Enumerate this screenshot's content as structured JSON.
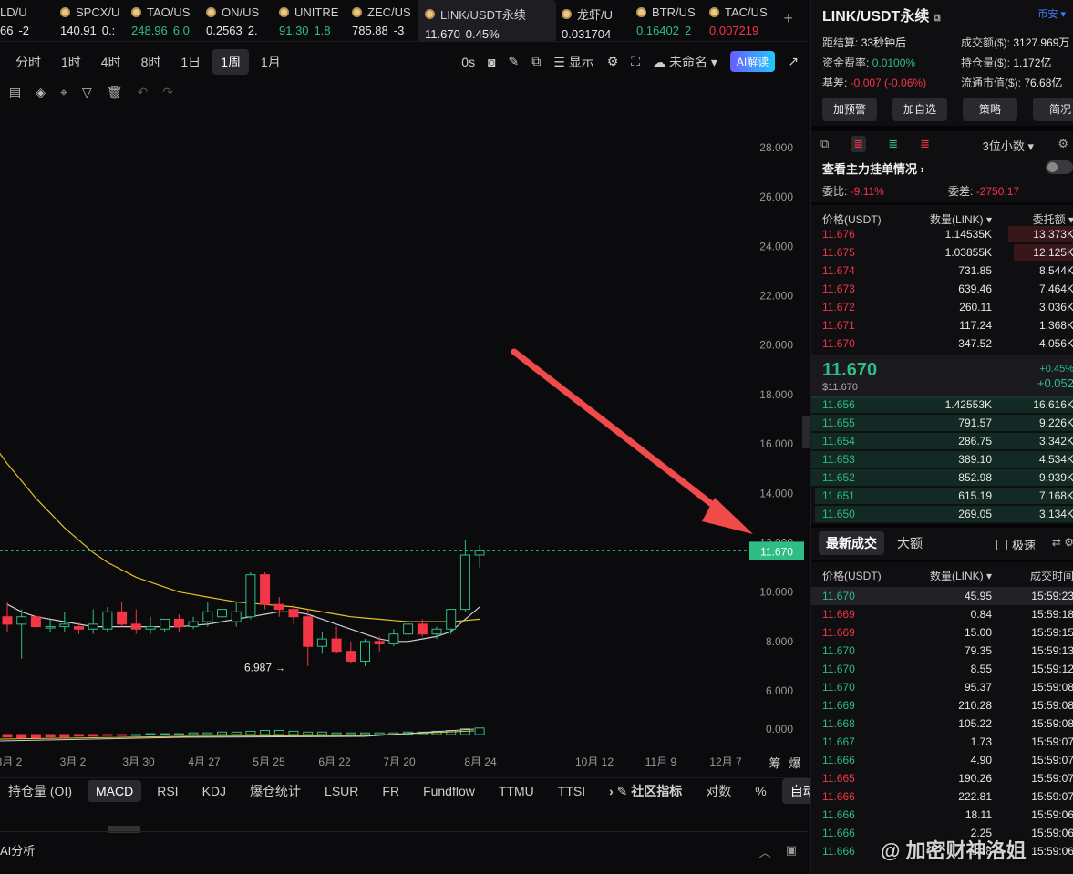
{
  "ticker": [
    {
      "name": "LD/U",
      "price": "66",
      "change": "-2",
      "pc": "wh",
      "cc": "wh",
      "dot": false,
      "w": 60
    },
    {
      "name": "SPCX/U",
      "price": "140.91",
      "change": "0.:",
      "pc": "wh",
      "cc": "wh",
      "dot": true,
      "w": 78
    },
    {
      "name": "TAO/US",
      "price": "248.96",
      "change": "6.0",
      "pc": "up",
      "cc": "up",
      "dot": true,
      "w": 82
    },
    {
      "name": "ON/US",
      "price": "0.2563",
      "change": "2.",
      "pc": "wh",
      "cc": "wh",
      "dot": true,
      "w": 80
    },
    {
      "name": "UNITRE",
      "price": "91.30",
      "change": "1.8",
      "pc": "up",
      "cc": "up",
      "dot": true,
      "w": 80
    },
    {
      "name": "ZEC/US",
      "price": "785.88",
      "change": "-3",
      "pc": "wh",
      "cc": "wh",
      "dot": true,
      "w": 78
    },
    {
      "name": "LINK/USDT永续",
      "price": "11.670",
      "change": "0.45%",
      "pc": "wh",
      "cc": "wh",
      "dot": true,
      "w": 152,
      "active": true
    },
    {
      "name": "龙虾/U",
      "price": "0.031704",
      "change": "",
      "pc": "wh",
      "cc": "wh",
      "dot": true,
      "w": 82
    },
    {
      "name": "BTR/US",
      "price": "0.16402",
      "change": "2",
      "pc": "up",
      "cc": "up",
      "dot": true,
      "w": 80
    },
    {
      "name": "TAC/US",
      "price": "0.007219",
      "change": "",
      "pc": "dn",
      "cc": "dn",
      "dot": true,
      "w": 80
    }
  ],
  "timeframes": [
    "分时",
    "1时",
    "4时",
    "8时",
    "1日",
    "1周",
    "1月"
  ],
  "active_timeframe": "1周",
  "toolbar_right": {
    "countdown": "0s",
    "display": "显示",
    "layout": "未命名",
    "ai": "AI解读"
  },
  "chart_data": {
    "type": "candlestick",
    "y_ticks": [
      "28.000",
      "26.000",
      "24.000",
      "22.000",
      "20.000",
      "18.000",
      "16.000",
      "14.000",
      "12.000",
      "10.000",
      "8.000",
      "6.000",
      "0.000"
    ],
    "x_ticks": [
      "8月 2",
      "3月 2",
      "3月 30",
      "4月 27",
      "5月 25",
      "6月 22",
      "7月 20",
      "8月 24",
      "10月 12",
      "11月 9",
      "12月 7"
    ],
    "last_price": "11.670",
    "low_marker": "6.987",
    "right_labels": [
      "筹",
      "爆"
    ],
    "candles": [
      {
        "o": 9.0,
        "h": 9.6,
        "l": 8.4,
        "c": 8.7
      },
      {
        "o": 8.7,
        "h": 9.3,
        "l": 7.3,
        "c": 9.0
      },
      {
        "o": 9.0,
        "h": 9.4,
        "l": 8.4,
        "c": 8.6
      },
      {
        "o": 8.6,
        "h": 8.9,
        "l": 8.4,
        "c": 8.6
      },
      {
        "o": 8.6,
        "h": 9.2,
        "l": 8.4,
        "c": 8.7
      },
      {
        "o": 8.6,
        "h": 8.8,
        "l": 8.3,
        "c": 8.5
      },
      {
        "o": 8.5,
        "h": 9.3,
        "l": 8.3,
        "c": 8.7
      },
      {
        "o": 8.5,
        "h": 9.4,
        "l": 8.4,
        "c": 9.2
      },
      {
        "o": 9.2,
        "h": 9.6,
        "l": 8.6,
        "c": 8.7
      },
      {
        "o": 8.7,
        "h": 9.3,
        "l": 8.3,
        "c": 8.5
      },
      {
        "o": 8.5,
        "h": 9.0,
        "l": 8.3,
        "c": 8.6
      },
      {
        "o": 8.5,
        "h": 8.9,
        "l": 8.4,
        "c": 8.9
      },
      {
        "o": 8.9,
        "h": 9.1,
        "l": 8.4,
        "c": 8.6
      },
      {
        "o": 8.6,
        "h": 9.0,
        "l": 8.5,
        "c": 8.8
      },
      {
        "o": 8.8,
        "h": 9.6,
        "l": 8.6,
        "c": 9.2
      },
      {
        "o": 9.0,
        "h": 9.7,
        "l": 8.8,
        "c": 9.3
      },
      {
        "o": 8.8,
        "h": 9.6,
        "l": 8.6,
        "c": 9.2
      },
      {
        "o": 9.0,
        "h": 10.8,
        "l": 8.9,
        "c": 10.7
      },
      {
        "o": 10.7,
        "h": 10.8,
        "l": 9.3,
        "c": 9.5
      },
      {
        "o": 9.5,
        "h": 9.8,
        "l": 9.0,
        "c": 9.3
      },
      {
        "o": 9.3,
        "h": 9.5,
        "l": 8.7,
        "c": 9.0
      },
      {
        "o": 9.0,
        "h": 9.3,
        "l": 7.0,
        "c": 7.8
      },
      {
        "o": 7.8,
        "h": 8.4,
        "l": 7.5,
        "c": 8.1
      },
      {
        "o": 8.1,
        "h": 8.6,
        "l": 7.5,
        "c": 7.6
      },
      {
        "o": 7.6,
        "h": 8.0,
        "l": 7.1,
        "c": 7.2
      },
      {
        "o": 7.2,
        "h": 8.1,
        "l": 7.0,
        "c": 8.0
      },
      {
        "o": 8.0,
        "h": 8.2,
        "l": 7.6,
        "c": 7.9
      },
      {
        "o": 7.9,
        "h": 8.5,
        "l": 7.8,
        "c": 8.3
      },
      {
        "o": 8.3,
        "h": 8.8,
        "l": 8.0,
        "c": 8.7
      },
      {
        "o": 8.7,
        "h": 8.9,
        "l": 8.2,
        "c": 8.3
      },
      {
        "o": 8.3,
        "h": 8.6,
        "l": 8.1,
        "c": 8.5
      },
      {
        "o": 8.5,
        "h": 9.3,
        "l": 8.3,
        "c": 9.3
      },
      {
        "o": 9.3,
        "h": 12.1,
        "l": 9.2,
        "c": 11.5
      },
      {
        "o": 11.5,
        "h": 11.9,
        "l": 11.0,
        "c": 11.67
      }
    ],
    "ma_white": [
      9.5,
      9.2,
      9.0,
      8.9,
      8.8,
      8.7,
      8.6,
      8.6,
      8.6,
      8.6,
      8.6,
      8.6,
      8.6,
      8.65,
      8.7,
      8.8,
      8.9,
      9.0,
      9.1,
      9.2,
      9.2,
      9.1,
      8.9,
      8.7,
      8.5,
      8.3,
      8.1,
      8.0,
      8.0,
      8.1,
      8.2,
      8.4,
      8.9,
      9.4
    ],
    "ma_yellow": [
      15.2,
      14.5,
      13.8,
      13.2,
      12.6,
      12.1,
      11.6,
      11.2,
      10.9,
      10.6,
      10.4,
      10.2,
      10.0,
      9.9,
      9.8,
      9.7,
      9.6,
      9.55,
      9.5,
      9.45,
      9.4,
      9.3,
      9.2,
      9.1,
      9.0,
      8.95,
      8.9,
      8.85,
      8.8,
      8.8,
      8.8,
      8.8,
      8.85,
      8.9
    ],
    "macd": [
      -0.03,
      -0.04,
      -0.04,
      -0.03,
      -0.03,
      -0.02,
      -0.02,
      -0.01,
      -0.01,
      0.0,
      0.01,
      0.01,
      0.01,
      0.02,
      0.02,
      0.03,
      0.03,
      0.04,
      0.05,
      0.05,
      0.04,
      0.03,
      0.03,
      0.02,
      0.02,
      0.02,
      0.02,
      0.02,
      0.03,
      0.03,
      0.04,
      0.05,
      0.07,
      0.08
    ]
  },
  "indicators": [
    "持仓量 (OI)",
    "MACD",
    "RSI",
    "KDJ",
    "爆仓统计",
    "LSUR",
    "FR",
    "Fundflow",
    "TTMU",
    "TTSI",
    "社区指标",
    "对数",
    "%",
    "自动"
  ],
  "active_indicator": "MACD",
  "ai_bar": {
    "label": "AI分析"
  },
  "panel": {
    "title": "LINK/USDT永续",
    "tag": "币安",
    "stats": [
      {
        "l1": "距结算:",
        "v1": "33秒钟后",
        "c1": "wh",
        "l2": "成交额($):",
        "v2": "3127.969万",
        "c2": "wh"
      },
      {
        "l1": "资金费率:",
        "v1": "0.0100%",
        "c1": "up",
        "l2": "持仓量($):",
        "v2": "1.172亿",
        "c2": "wh"
      },
      {
        "l1": "基差:",
        "v1": "-0.007 (-0.06%)",
        "c1": "dn",
        "l2": "流通市值($):",
        "v2": "76.68亿",
        "c2": "wh"
      }
    ],
    "buttons": [
      "加预警",
      "加自选",
      "策略",
      "简况"
    ],
    "decimals": "3位小数",
    "main_orders": "查看主力挂单情况",
    "ratio_label": "委比:",
    "ratio_value": "-9.11%",
    "diff_label": "委差:",
    "diff_value": "-2750.17",
    "ob_headers": {
      "price": "价格(USDT)",
      "qty": "数量(LINK)",
      "total": "委托额"
    },
    "asks": [
      {
        "p": "11.676",
        "q": "1.14535K",
        "t": "13.373K",
        "w": 72
      },
      {
        "p": "11.675",
        "q": "1.03855K",
        "t": "12.125K",
        "w": 66
      },
      {
        "p": "11.674",
        "q": "731.85",
        "t": "8.544K",
        "w": 0
      },
      {
        "p": "11.673",
        "q": "639.46",
        "t": "7.464K",
        "w": 0
      },
      {
        "p": "11.672",
        "q": "260.11",
        "t": "3.036K",
        "w": 0
      },
      {
        "p": "11.671",
        "q": "117.24",
        "t": "1.368K",
        "w": 0
      },
      {
        "p": "11.670",
        "q": "347.52",
        "t": "4.056K",
        "w": 0
      }
    ],
    "mid_price": "11.670",
    "mid_sub": "$11.670",
    "mid_pct": "+0.45%",
    "mid_abs": "+0.052",
    "bids": [
      {
        "p": "11.656",
        "q": "1.42553K",
        "t": "16.616K",
        "w": 288
      },
      {
        "p": "11.655",
        "q": "791.57",
        "t": "9.226K",
        "w": 288
      },
      {
        "p": "11.654",
        "q": "286.75",
        "t": "3.342K",
        "w": 288
      },
      {
        "p": "11.653",
        "q": "389.10",
        "t": "4.534K",
        "w": 288
      },
      {
        "p": "11.652",
        "q": "852.98",
        "t": "9.939K",
        "w": 288
      },
      {
        "p": "11.651",
        "q": "615.19",
        "t": "7.168K",
        "w": 284
      },
      {
        "p": "11.650",
        "q": "269.05",
        "t": "3.134K",
        "w": 284
      }
    ],
    "trade_tabs": [
      "最新成交",
      "大额"
    ],
    "fast_label": "极速",
    "tr_headers": {
      "price": "价格(USDT)",
      "qty": "数量(LINK)",
      "time": "成交时间"
    },
    "trades": [
      {
        "p": "11.670",
        "q": "45.95",
        "t": "15:59:23",
        "c": "up"
      },
      {
        "p": "11.669",
        "q": "0.84",
        "t": "15:59:18",
        "c": "dn"
      },
      {
        "p": "11.669",
        "q": "15.00",
        "t": "15:59:15",
        "c": "dn"
      },
      {
        "p": "11.670",
        "q": "79.35",
        "t": "15:59:13",
        "c": "up"
      },
      {
        "p": "11.670",
        "q": "8.55",
        "t": "15:59:12",
        "c": "up"
      },
      {
        "p": "11.670",
        "q": "95.37",
        "t": "15:59:08",
        "c": "up"
      },
      {
        "p": "11.669",
        "q": "210.28",
        "t": "15:59:08",
        "c": "up"
      },
      {
        "p": "11.668",
        "q": "105.22",
        "t": "15:59:08",
        "c": "up"
      },
      {
        "p": "11.667",
        "q": "1.73",
        "t": "15:59:07",
        "c": "up"
      },
      {
        "p": "11.666",
        "q": "4.90",
        "t": "15:59:07",
        "c": "up"
      },
      {
        "p": "11.665",
        "q": "190.26",
        "t": "15:59:07",
        "c": "dn"
      },
      {
        "p": "11.666",
        "q": "222.81",
        "t": "15:59:07",
        "c": "dn"
      },
      {
        "p": "11.666",
        "q": "18.11",
        "t": "15:59:06",
        "c": "up"
      },
      {
        "p": "11.666",
        "q": "2.25",
        "t": "15:59:06",
        "c": "up"
      },
      {
        "p": "11.666",
        "q": "0.68",
        "t": "15:59:06",
        "c": "up"
      }
    ]
  },
  "watermark": "@ 加密财神洛姐"
}
